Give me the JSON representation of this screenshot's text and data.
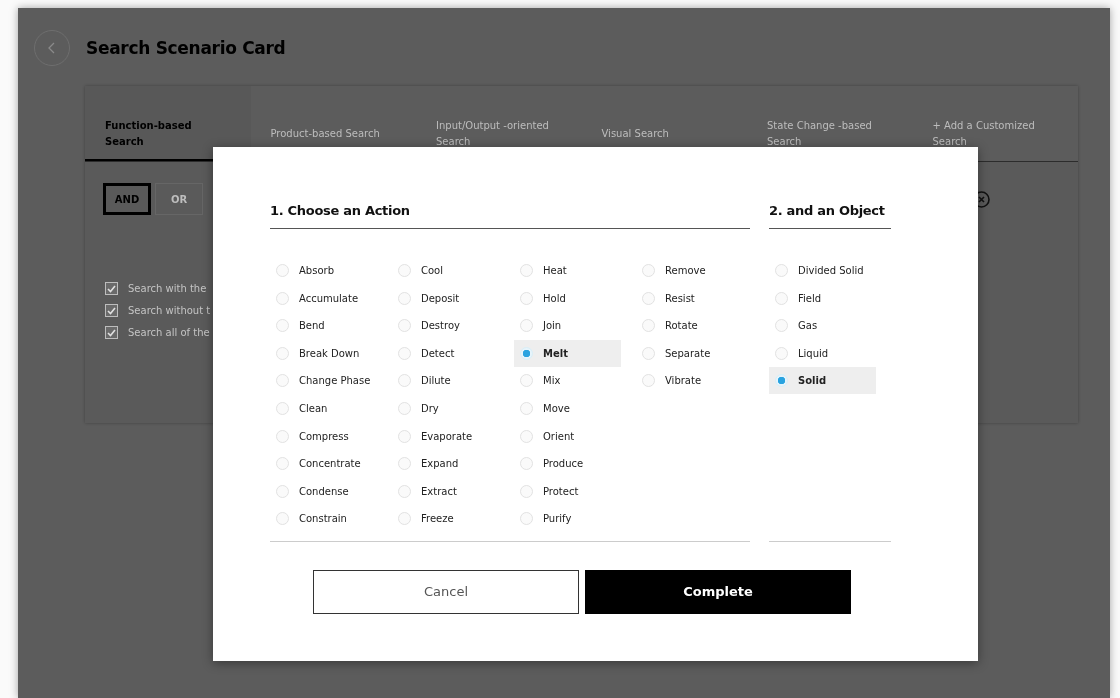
{
  "page": {
    "title": "Search Scenario Card"
  },
  "tabs": [
    {
      "label": "Function-based Search",
      "selected": true
    },
    {
      "label": "Product-based Search",
      "selected": false
    },
    {
      "label": "Input/Output -oriented Search",
      "selected": false
    },
    {
      "label": "Visual Search",
      "selected": false
    },
    {
      "label": "State Change -based Search",
      "selected": false
    },
    {
      "label": "+ Add a Customized Search",
      "selected": false
    }
  ],
  "logic_toggle": [
    {
      "label": "AND",
      "selected": true
    },
    {
      "label": "OR",
      "selected": false
    }
  ],
  "options": [
    {
      "label": "Search with the",
      "checked": true
    },
    {
      "label": "Search without t",
      "checked": true
    },
    {
      "label": "Search all of the",
      "checked": true
    }
  ],
  "dialog": {
    "action_heading": "1. Choose an Action",
    "object_heading": "2. and an Object",
    "actions": [
      {
        "label": "Absorb",
        "selected": false
      },
      {
        "label": "Accumulate",
        "selected": false
      },
      {
        "label": "Bend",
        "selected": false
      },
      {
        "label": "Break Down",
        "selected": false
      },
      {
        "label": "Change Phase",
        "selected": false
      },
      {
        "label": "Clean",
        "selected": false
      },
      {
        "label": "Compress",
        "selected": false
      },
      {
        "label": "Concentrate",
        "selected": false
      },
      {
        "label": "Condense",
        "selected": false
      },
      {
        "label": "Constrain",
        "selected": false
      },
      {
        "label": "Cool",
        "selected": false
      },
      {
        "label": "Deposit",
        "selected": false
      },
      {
        "label": "Destroy",
        "selected": false
      },
      {
        "label": "Detect",
        "selected": false
      },
      {
        "label": "Dilute",
        "selected": false
      },
      {
        "label": "Dry",
        "selected": false
      },
      {
        "label": "Evaporate",
        "selected": false
      },
      {
        "label": "Expand",
        "selected": false
      },
      {
        "label": "Extract",
        "selected": false
      },
      {
        "label": "Freeze",
        "selected": false
      },
      {
        "label": "Heat",
        "selected": false
      },
      {
        "label": "Hold",
        "selected": false
      },
      {
        "label": "Join",
        "selected": false
      },
      {
        "label": "Melt",
        "selected": true
      },
      {
        "label": "Mix",
        "selected": false
      },
      {
        "label": "Move",
        "selected": false
      },
      {
        "label": "Orient",
        "selected": false
      },
      {
        "label": "Produce",
        "selected": false
      },
      {
        "label": "Protect",
        "selected": false
      },
      {
        "label": "Purify",
        "selected": false
      },
      {
        "label": "Remove",
        "selected": false
      },
      {
        "label": "Resist",
        "selected": false
      },
      {
        "label": "Rotate",
        "selected": false
      },
      {
        "label": "Separate",
        "selected": false
      },
      {
        "label": "Vibrate",
        "selected": false
      }
    ],
    "objects": [
      {
        "label": "Divided Solid",
        "selected": false
      },
      {
        "label": "Field",
        "selected": false
      },
      {
        "label": "Gas",
        "selected": false
      },
      {
        "label": "Liquid",
        "selected": false
      },
      {
        "label": "Solid",
        "selected": true
      }
    ],
    "buttons": [
      {
        "label": "Cancel",
        "kind": "secondary"
      },
      {
        "label": "Complete",
        "kind": "primary"
      }
    ]
  }
}
